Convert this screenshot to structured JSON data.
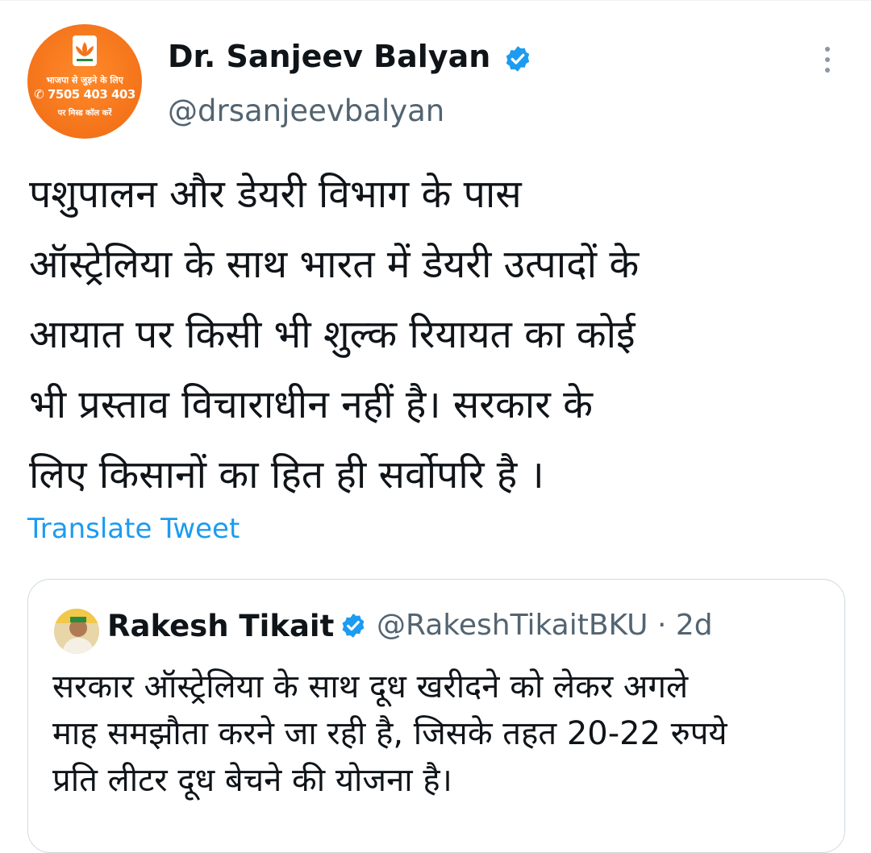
{
  "tweet": {
    "author": {
      "name": "Dr. Sanjeev Balyan",
      "handle": "@drsanjeevbalyan",
      "avatar": {
        "line1": "भाजपा से जुड़ने के लिए",
        "phone": "7505 403 403",
        "line3": "पर मिस्ड कॉल करें",
        "bg_color": "#f4731a"
      },
      "verified_icon": "verified-badge-icon"
    },
    "more_icon": "more-options-icon",
    "text_lines": [
      "पशुपालन और डेयरी विभाग के पास",
      "ऑस्ट्रेलिया के साथ भारत में डेयरी उत्पादों के",
      "आयात पर किसी भी शुल्क रियायत का कोई",
      "भी प्रस्ताव विचाराधीन नहीं है। सरकार के",
      "लिए किसानों का हित ही सर्वोपरि है ।"
    ],
    "translate_label": "Translate Tweet"
  },
  "quoted_tweet": {
    "author": {
      "name": "Rakesh Tikait",
      "handle": "@RakeshTikaitBKU · 2d",
      "verified_icon": "verified-badge-icon"
    },
    "text_lines": [
      "सरकार ऑस्ट्रेलिया के साथ दूध खरीदने को लेकर अगले",
      "माह समझौता करने जा रही है, जिसके तहत 20-22 रुपये",
      "प्रति लीटर दूध बेचने की योजना है।"
    ]
  },
  "colors": {
    "accent": "#1d9bf0",
    "text": "#0f1419",
    "secondary": "#536471",
    "border": "#cfd9de"
  }
}
